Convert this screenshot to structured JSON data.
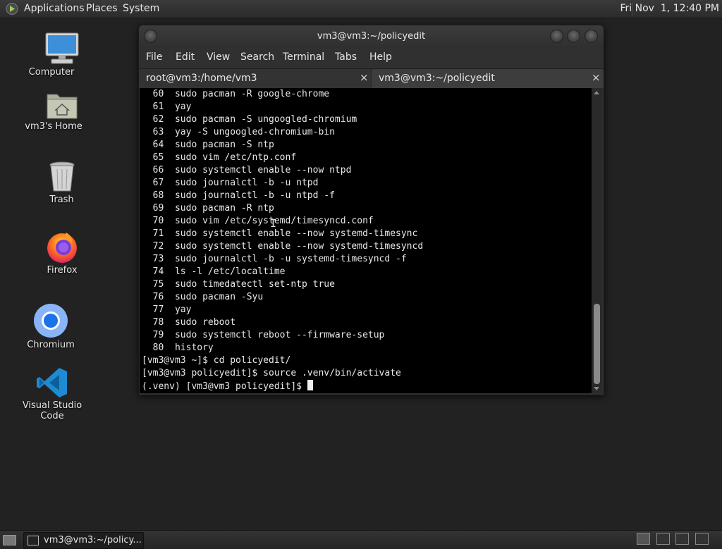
{
  "top_panel": {
    "menus": [
      "Applications",
      "Places",
      "System"
    ],
    "clock": "Fri Nov  1, 12:40 PM"
  },
  "desktop_icons": [
    {
      "label": "Computer",
      "icon": "computer-icon"
    },
    {
      "label": "vm3's Home",
      "icon": "home-folder-icon"
    },
    {
      "label": "Trash",
      "icon": "trash-icon"
    },
    {
      "label": "Firefox",
      "icon": "firefox-icon"
    },
    {
      "label": "Chromium",
      "icon": "chromium-icon"
    },
    {
      "label": "Visual Studio Code",
      "icon": "vscode-icon"
    }
  ],
  "window": {
    "title": "vm3@vm3:~/policyedit",
    "menu": [
      "File",
      "Edit",
      "View",
      "Search",
      "Terminal",
      "Tabs",
      "Help"
    ],
    "tabs": [
      {
        "label": "root@vm3:/home/vm3",
        "close": "×",
        "active": false
      },
      {
        "label": "vm3@vm3:~/policyedit",
        "close": "×",
        "active": true
      }
    ],
    "terminal_lines": [
      "  60  sudo pacman -R google-chrome",
      "  61  yay",
      "  62  sudo pacman -S ungoogled-chromium",
      "  63  yay -S ungoogled-chromium-bin",
      "  64  sudo pacman -S ntp",
      "  65  sudo vim /etc/ntp.conf",
      "  66  sudo systemctl enable --now ntpd",
      "  67  sudo journalctl -b -u ntpd",
      "  68  sudo journalctl -b -u ntpd -f",
      "  69  sudo pacman -R ntp",
      "  70  sudo vim /etc/systemd/timesyncd.conf",
      "  71  sudo systemctl enable --now systemd-timesync",
      "  72  sudo systemctl enable --now systemd-timesyncd",
      "  73  sudo journalctl -b -u systemd-timesyncd -f",
      "  74  ls -l /etc/localtime",
      "  75  sudo timedatectl set-ntp true",
      "  76  sudo pacman -Syu",
      "  77  yay",
      "  78  sudo reboot",
      "  79  sudo systemctl reboot --firmware-setup",
      "  80  history",
      "[vm3@vm3 ~]$ cd policyedit/",
      "[vm3@vm3 policyedit]$ source .venv/bin/activate"
    ],
    "prompt": "(.venv) [vm3@vm3 policyedit]$ "
  },
  "taskbar": {
    "task_label": "vm3@vm3:~/policy..."
  }
}
